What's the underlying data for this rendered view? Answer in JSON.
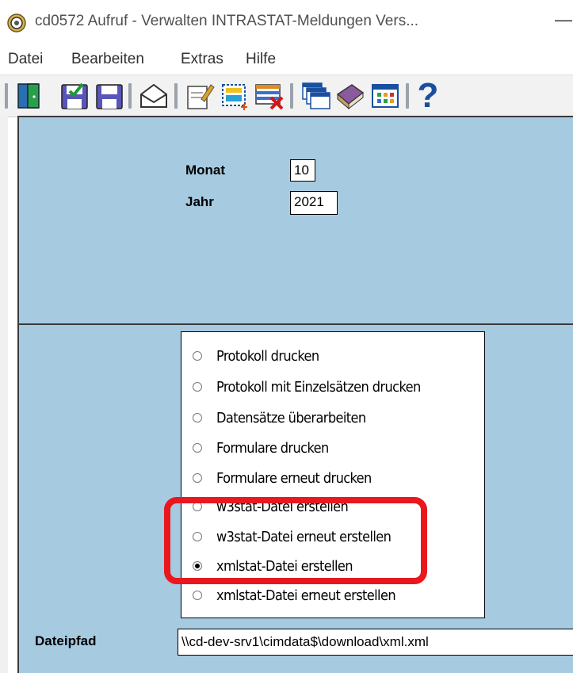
{
  "window": {
    "title": "cd0572 Aufruf - Verwalten INTRASTAT-Meldungen Vers...",
    "minimize_glyph": "—",
    "icon": "gear-icon"
  },
  "menu": {
    "items": [
      "Datei",
      "Bearbeiten",
      "Extras",
      "Hilfe"
    ]
  },
  "toolbar": {
    "buttons": [
      "exit-door-icon",
      "save-check-icon",
      "save-icon",
      "envelope-icon",
      "edit-document-icon",
      "new-record-icon",
      "delete-record-icon",
      "windows-icon",
      "book-icon",
      "table-icon",
      "help-icon"
    ],
    "help_label": "?"
  },
  "form": {
    "monat_label": "Monat",
    "monat_value": "10",
    "jahr_label": "Jahr",
    "jahr_value": "2021"
  },
  "options": {
    "items": [
      {
        "label": "Protokoll drucken",
        "selected": false
      },
      {
        "label": "Protokoll mit Einzelsätzen drucken",
        "selected": false
      },
      {
        "label": "Datensätze überarbeiten",
        "selected": false
      },
      {
        "label": "Formulare drucken",
        "selected": false
      },
      {
        "label": "Formulare erneut drucken",
        "selected": false
      },
      {
        "label": "w3stat-Datei erstellen",
        "selected": false
      },
      {
        "label": "w3stat-Datei erneut erstellen",
        "selected": false
      },
      {
        "label": "xmlstat-Datei erstellen",
        "selected": true
      },
      {
        "label": "xmlstat-Datei erneut erstellen",
        "selected": false
      }
    ]
  },
  "dateipfad": {
    "label": "Dateipfad",
    "value": "\\\\cd-dev-srv1\\cimdata$\\download\\xml.xml"
  },
  "colors": {
    "panel_bg": "#a6cae0",
    "highlight": "#e8181e"
  }
}
